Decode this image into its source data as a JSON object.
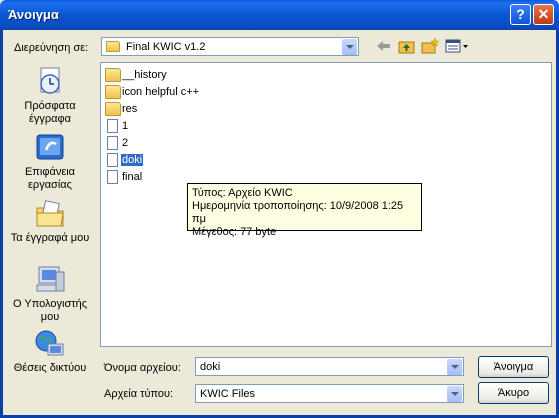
{
  "window": {
    "title": "Άνοιγμα"
  },
  "lookin": {
    "label": "Διερεύνηση σε:",
    "value": "Final KWIC v1.2"
  },
  "toolbar_icons": [
    "back-icon",
    "up-folder-icon",
    "new-folder-icon",
    "views-menu-icon"
  ],
  "places": [
    {
      "label": "Πρόσφατα έγγραφα",
      "icon": "recent-documents-icon"
    },
    {
      "label": "Επιφάνεια εργασίας",
      "icon": "desktop-icon"
    },
    {
      "label": "Τα έγγραφά μου",
      "icon": "my-documents-icon"
    },
    {
      "label": "Ο Υπολογιστής μου",
      "icon": "my-computer-icon"
    },
    {
      "label": "Θέσεις δικτύου",
      "icon": "network-places-icon"
    }
  ],
  "files": [
    {
      "name": "__history",
      "type": "folder"
    },
    {
      "name": "icon helpful c++",
      "type": "folder"
    },
    {
      "name": "res",
      "type": "folder"
    },
    {
      "name": "1",
      "type": "file"
    },
    {
      "name": "2",
      "type": "file"
    },
    {
      "name": "doki",
      "type": "file",
      "selected": true
    },
    {
      "name": "final",
      "type": "file"
    }
  ],
  "tooltip": {
    "line1": "Τύπος: Αρχείο KWIC",
    "line2": "Ημερομηνία τροποποίησης: 10/9/2008 1:25 πμ",
    "line3": "Μέγεθος: 77 byte"
  },
  "filename": {
    "label": "Όνομα αρχείου:",
    "value": "doki"
  },
  "filetype": {
    "label": "Αρχεία τύπου:",
    "value": "KWIC Files"
  },
  "buttons": {
    "open": "Άνοιγμα",
    "cancel": "Άκυρο"
  },
  "colors": {
    "titlebar": "#0a5bd8",
    "selection": "#316ac5",
    "tooltip_bg": "#ffffe1",
    "dialog_bg": "#ece9d8"
  }
}
